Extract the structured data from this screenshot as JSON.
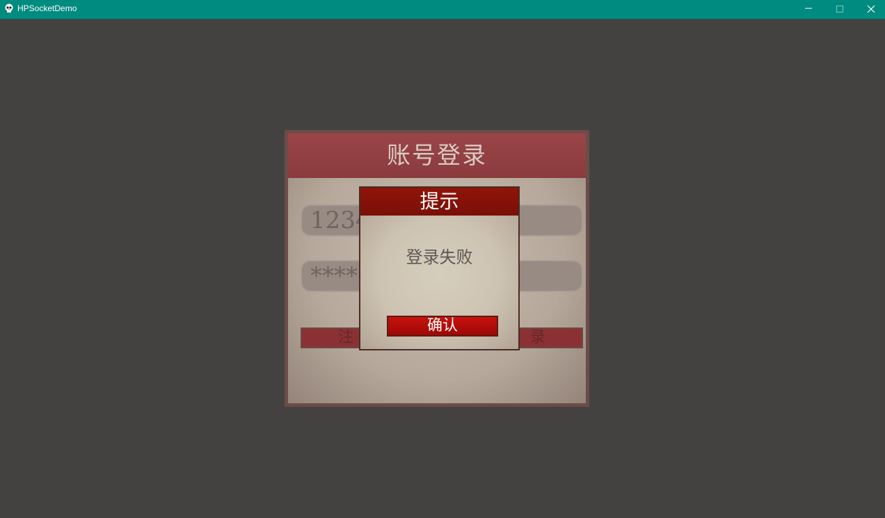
{
  "window": {
    "title": "HPSocketDemo",
    "icon": "app-skull-icon",
    "controls": [
      "minimize-icon",
      "maximize-icon",
      "close-icon"
    ]
  },
  "login": {
    "header": "账号登录",
    "username_value": "1234",
    "password_value": "****",
    "register_label_visible": "注",
    "login_label_visible": "录"
  },
  "dialog": {
    "title": "提示",
    "message": "登录失败",
    "confirm_label": "确认"
  },
  "colors": {
    "titlebar": "#008b80",
    "background": "#444240",
    "dialog_header": "#8f1409",
    "confirm_button": "#c8120e"
  }
}
